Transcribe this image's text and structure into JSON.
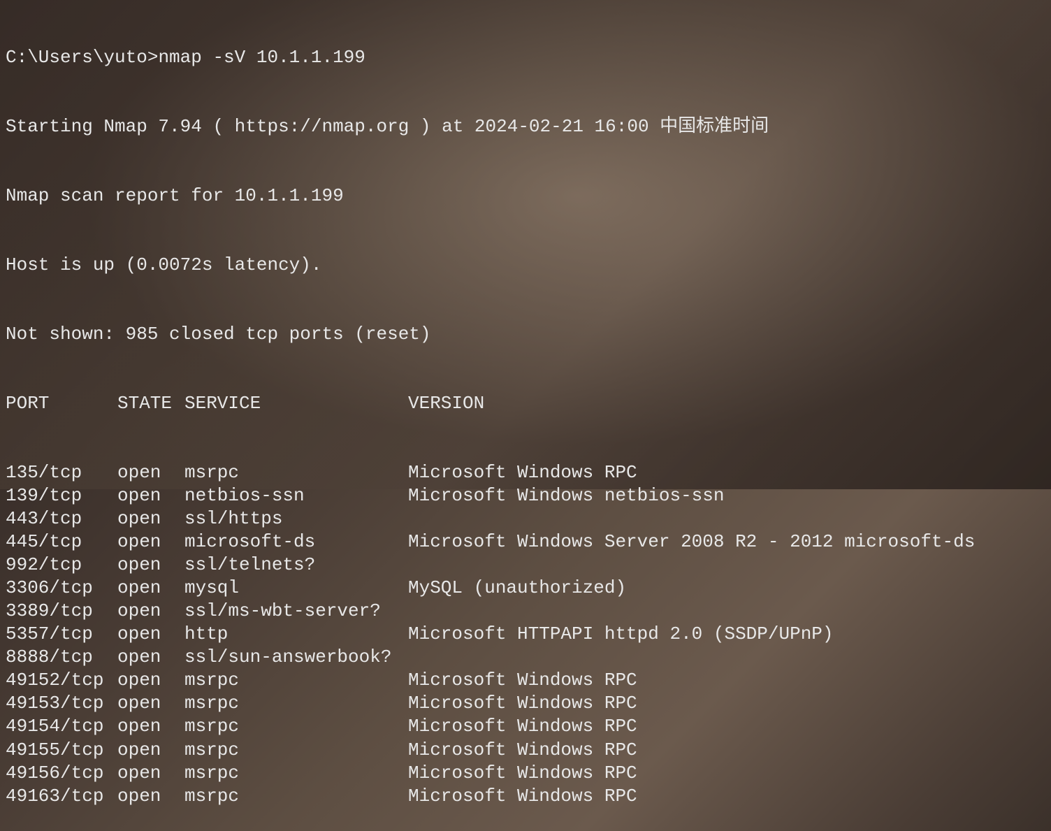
{
  "prompt": "C:\\Users\\yuto>",
  "command": "nmap -sV 10.1.1.199",
  "header_lines": [
    "Starting Nmap 7.94 ( https://nmap.org ) at 2024-02-21 16:00 中国标准时间",
    "Nmap scan report for 10.1.1.199",
    "Host is up (0.0072s latency).",
    "Not shown: 985 closed tcp ports (reset)"
  ],
  "table_header": {
    "port": "PORT",
    "state": "STATE",
    "service": "SERVICE",
    "version": "VERSION"
  },
  "rows": [
    {
      "port": "135/tcp",
      "state": "open",
      "service": "msrpc",
      "version": "Microsoft Windows RPC"
    },
    {
      "port": "139/tcp",
      "state": "open",
      "service": "netbios-ssn",
      "version": "Microsoft Windows netbios-ssn"
    },
    {
      "port": "443/tcp",
      "state": "open",
      "service": "ssl/https",
      "version": ""
    },
    {
      "port": "445/tcp",
      "state": "open",
      "service": "microsoft-ds",
      "version": "Microsoft Windows Server 2008 R2 - 2012 microsoft-ds"
    },
    {
      "port": "992/tcp",
      "state": "open",
      "service": "ssl/telnets?",
      "version": ""
    },
    {
      "port": "3306/tcp",
      "state": "open",
      "service": "mysql",
      "version": "MySQL (unauthorized)"
    },
    {
      "port": "3389/tcp",
      "state": "open",
      "service": "ssl/ms-wbt-server?",
      "version": ""
    },
    {
      "port": "5357/tcp",
      "state": "open",
      "service": "http",
      "version": "Microsoft HTTPAPI httpd 2.0 (SSDP/UPnP)"
    },
    {
      "port": "8888/tcp",
      "state": "open",
      "service": "ssl/sun-answerbook?",
      "version": ""
    },
    {
      "port": "49152/tcp",
      "state": "open",
      "service": "msrpc",
      "version": "Microsoft Windows RPC"
    },
    {
      "port": "49153/tcp",
      "state": "open",
      "service": "msrpc",
      "version": "Microsoft Windows RPC"
    },
    {
      "port": "49154/tcp",
      "state": "open",
      "service": "msrpc",
      "version": "Microsoft Windows RPC"
    },
    {
      "port": "49155/tcp",
      "state": "open",
      "service": "msrpc",
      "version": "Microsoft Windows RPC"
    },
    {
      "port": "49156/tcp",
      "state": "open",
      "service": "msrpc",
      "version": "Microsoft Windows RPC"
    },
    {
      "port": "49163/tcp",
      "state": "open",
      "service": "msrpc",
      "version": "Microsoft Windows RPC"
    }
  ]
}
